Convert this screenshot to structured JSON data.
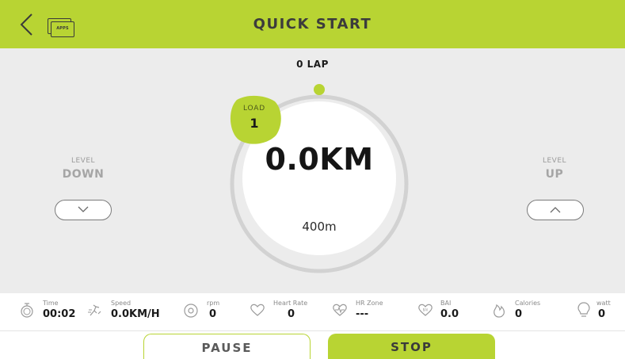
{
  "colors": {
    "accent": "#b8d433",
    "panel": "#ececec",
    "ring": "#d2d2d2"
  },
  "header": {
    "title": "QUICK START",
    "apps_label": "APPS",
    "back_icon": "chevron-left-icon",
    "apps_icon": "apps-icon"
  },
  "workout": {
    "lap_label": "0 LAP",
    "lap_progress": 0,
    "distance": "0.0KM",
    "lap_length": "400m",
    "load": {
      "label": "LOAD",
      "value": "1"
    }
  },
  "level_down": {
    "small": "LEVEL",
    "big": "DOWN",
    "icon": "chevron-down-icon"
  },
  "level_up": {
    "small": "LEVEL",
    "big": "UP",
    "icon": "chevron-up-icon"
  },
  "stats": [
    {
      "label": "Time",
      "value": "00:02",
      "icon": "stopwatch-icon"
    },
    {
      "label": "Speed",
      "value": "0.0KM/H",
      "icon": "runner-icon"
    },
    {
      "label": "rpm",
      "value": "0",
      "icon": "rpm-icon"
    },
    {
      "label": "Heart Rate",
      "value": "0",
      "icon": "heart-icon"
    },
    {
      "label": "HR Zone",
      "value": "---",
      "icon": "heart-pulse-icon"
    },
    {
      "label": "BAI",
      "value": "0.0",
      "icon": "bai-heart-icon"
    },
    {
      "label": "Calories",
      "value": "0",
      "icon": "flame-icon"
    },
    {
      "label": "watt",
      "value": "0",
      "icon": "bulb-icon"
    }
  ],
  "buttons": {
    "pause": "PAUSE",
    "stop": "STOP"
  }
}
